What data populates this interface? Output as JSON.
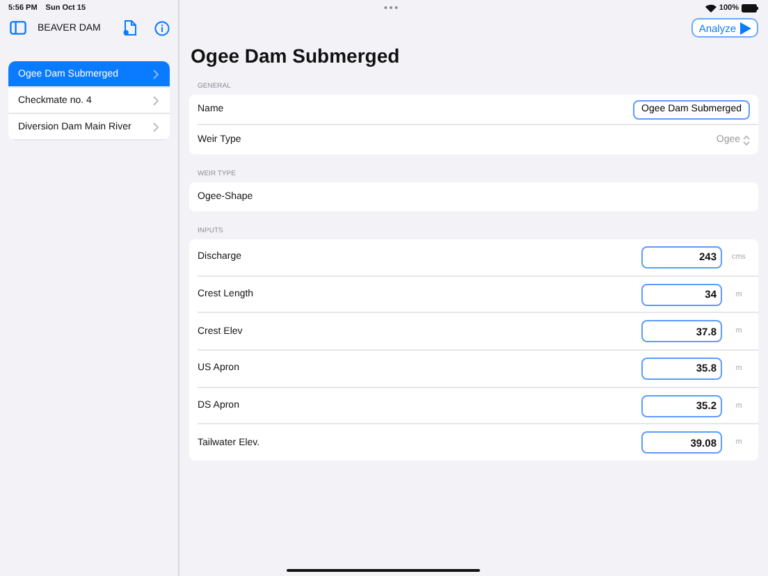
{
  "status_bar": {
    "time": "5:56 PM",
    "date": "Sun Oct 15",
    "battery": "100%"
  },
  "sidebar": {
    "title": "BEAVER DAM",
    "items": [
      {
        "label": "Ogee Dam Submerged",
        "selected": true
      },
      {
        "label": "Checkmate no. 4",
        "selected": false
      },
      {
        "label": "Diversion Dam Main River",
        "selected": false
      }
    ]
  },
  "toolbar": {
    "analyze_button": "Analyze"
  },
  "detail": {
    "title": "Ogee Dam Submerged",
    "general": {
      "header": "GENERAL",
      "name_label": "Name",
      "name_value": "Ogee Dam Submerged",
      "weir_type_label": "Weir Type",
      "weir_type_value": "Ogee"
    },
    "weir_type": {
      "header": "WEIR TYPE",
      "value": "Ogee-Shape"
    },
    "inputs": {
      "header": "INPUTS",
      "rows": [
        {
          "label": "Discharge",
          "value": "243",
          "unit": "cms"
        },
        {
          "label": "Crest Length",
          "value": "34",
          "unit": "m"
        },
        {
          "label": "Crest Elev",
          "value": "37.8",
          "unit": "m"
        },
        {
          "label": "US Apron",
          "value": "35.8",
          "unit": "m"
        },
        {
          "label": "DS Apron",
          "value": "35.2",
          "unit": "m"
        },
        {
          "label": "Tailwater Elev.",
          "value": "39.08",
          "unit": "m"
        }
      ]
    }
  }
}
